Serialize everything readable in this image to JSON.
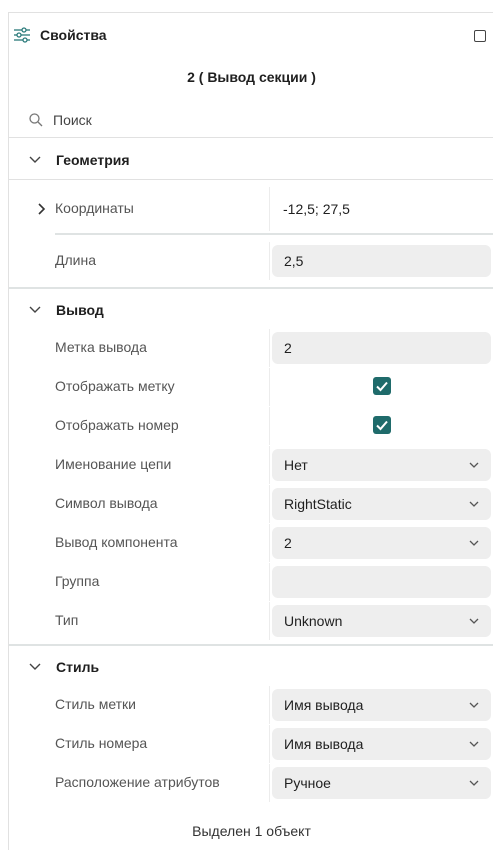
{
  "header": {
    "title": "Свойства",
    "icon": "sliders-icon",
    "maximize_icon": "maximize-icon"
  },
  "subtitle": "2 ( Вывод секции )",
  "search": {
    "placeholder": "Поиск"
  },
  "sections": {
    "geometry": {
      "title": "Геометрия",
      "coords_label": "Координаты",
      "coords_value": "-12,5; 27,5",
      "length_label": "Длина",
      "length_value": "2,5"
    },
    "pin": {
      "title": "Вывод",
      "rows": [
        {
          "label": "Метка вывода",
          "value": "2",
          "kind": "text"
        },
        {
          "label": "Отображать метку",
          "value": "checked",
          "kind": "checkbox"
        },
        {
          "label": "Отображать номер",
          "value": "checked",
          "kind": "checkbox"
        },
        {
          "label": "Именование цепи",
          "value": "Нет",
          "kind": "select"
        },
        {
          "label": "Символ вывода",
          "value": "RightStatic",
          "kind": "select"
        },
        {
          "label": "Вывод компонента",
          "value": "2",
          "kind": "select"
        },
        {
          "label": "Группа",
          "value": "",
          "kind": "text"
        },
        {
          "label": "Тип",
          "value": "Unknown",
          "kind": "select"
        }
      ]
    },
    "style": {
      "title": "Стиль",
      "rows": [
        {
          "label": "Стиль метки",
          "value": "Имя вывода",
          "kind": "select"
        },
        {
          "label": "Стиль номера",
          "value": "Имя вывода",
          "kind": "select"
        },
        {
          "label": "Расположение атрибутов",
          "value": "Ручное",
          "kind": "select"
        }
      ]
    }
  },
  "footer": "Выделен 1 объект",
  "colors": {
    "accent": "#1f6b6b",
    "field_bg": "#eeeeee",
    "divider": "#e1e1e1"
  }
}
